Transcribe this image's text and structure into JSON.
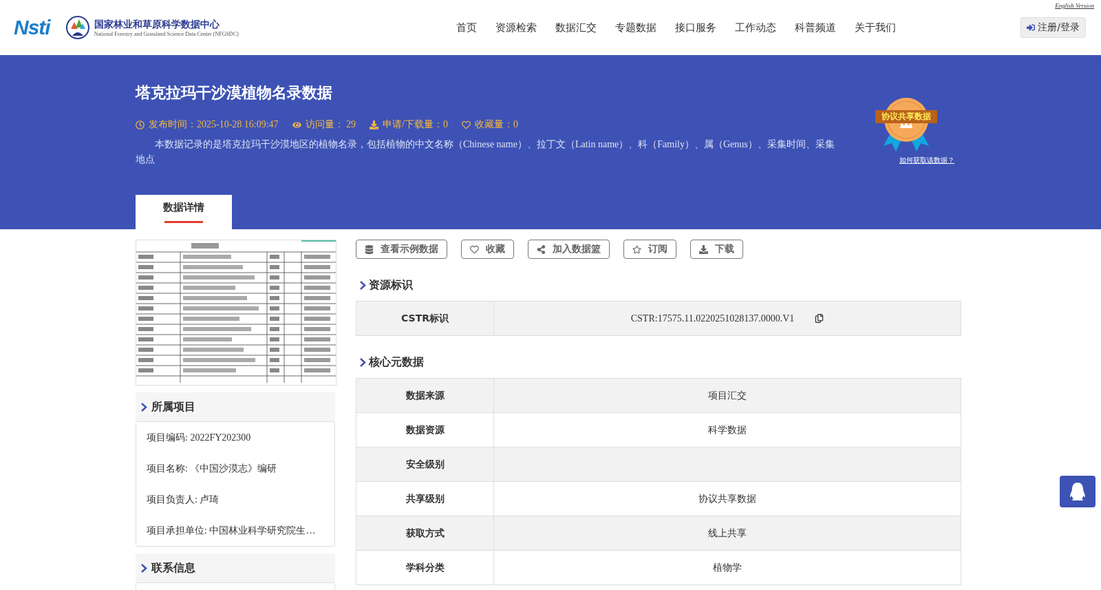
{
  "header": {
    "logo_text": "Nsti",
    "center_name": "国家林业和草原科学数据中心",
    "center_name_en": "National Forestry and Grassland Science Data Center (NFGSDC)",
    "nav": [
      {
        "label": "首页",
        "selected": false
      },
      {
        "label": "资源检索",
        "selected": false
      },
      {
        "label": "数据汇交",
        "selected": false
      },
      {
        "label": "专题数据",
        "selected": false
      },
      {
        "label": "接口服务",
        "selected": false
      },
      {
        "label": "工作动态",
        "selected": false
      },
      {
        "label": "科普频道",
        "selected": false
      },
      {
        "label": "关于我们",
        "selected": false
      }
    ],
    "english_link": "English Version",
    "login": "注册/登录"
  },
  "banner": {
    "title": "塔克拉玛干沙漠植物名录数据",
    "meta": [
      {
        "kind": "time",
        "text": "发布时间：2025-10-28 16:09:47"
      },
      {
        "kind": "views",
        "text": "访问量： 29"
      },
      {
        "kind": "downloads",
        "text": "申请/下载量：0"
      },
      {
        "kind": "favorites",
        "text": "收藏量：0"
      }
    ],
    "description": "本数据记录的是塔克拉玛干沙漠地区的植物名录，包括植物的中文名称（Chinese name）、拉丁文（Latin name）、科（Family）、属（Genus）、采集时间、采集地点",
    "badge": "协议共享数据",
    "badge_link": "如何获取该数据？"
  },
  "tabs": [
    {
      "label": "数据详情",
      "selected": true
    }
  ],
  "sidebar": {
    "sections": [
      {
        "title": "所属项目",
        "items": [
          "项目编码: 2022FY202300",
          "项目名称: 《中国沙漠志》编研",
          "项目负责人: 卢琦",
          "项目承担单位: 中国林业科学研究院生…"
        ]
      },
      {
        "title": "联系信息"
      }
    ]
  },
  "actions": [
    {
      "kind": "database",
      "label": "查看示例数据"
    },
    {
      "kind": "heart",
      "label": "收藏"
    },
    {
      "kind": "share",
      "label": "加入数据篮"
    },
    {
      "kind": "star",
      "label": "订阅"
    },
    {
      "kind": "download",
      "label": "下载"
    }
  ],
  "sections": [
    {
      "title": "资源标识",
      "rows": [
        {
          "label": "CSTR标识",
          "value": "CSTR:17575.11.0220251028137.0000.V1",
          "copy": true
        }
      ]
    },
    {
      "title": "核心元数据",
      "rows": [
        {
          "label": "数据来源",
          "value": "项目汇交"
        },
        {
          "label": "数据资源",
          "value": "科学数据"
        },
        {
          "label": "安全级别"
        },
        {
          "label": "共享级别",
          "value": "协议共享数据"
        },
        {
          "label": "获取方式",
          "value": "线上共享"
        },
        {
          "label": "学科分类",
          "value": "植物学"
        }
      ]
    }
  ]
}
